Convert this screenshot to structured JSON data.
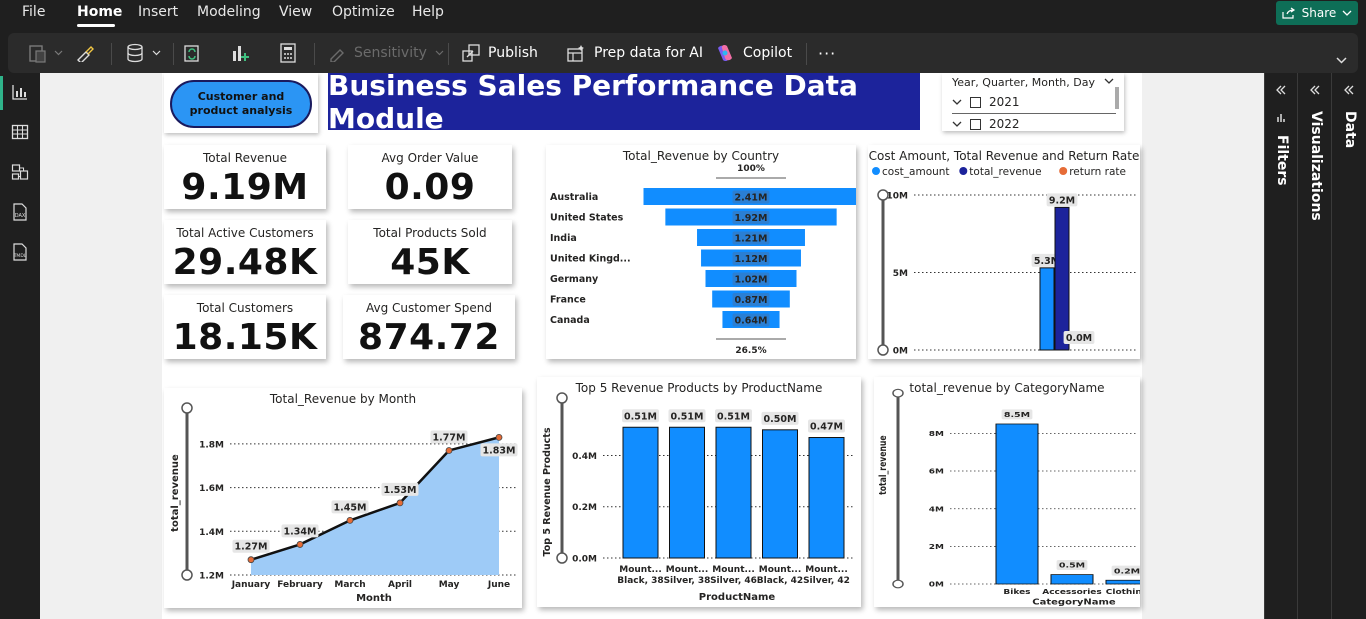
{
  "menubar": {
    "items": [
      "File",
      "Home",
      "Insert",
      "Modeling",
      "View",
      "Optimize",
      "Help"
    ],
    "share_label": "Share"
  },
  "ribbon": {
    "sensitivity_label": "Sensitivity",
    "publish_label": "Publish",
    "prep_label": "Prep data for AI",
    "copilot_label": "Copilot",
    "more_label": "···"
  },
  "panes": {
    "filters_label": "Filters",
    "visualizations_label": "Visualizations",
    "data_label": "Data"
  },
  "report": {
    "nav_button_label": "Customer and product analysis",
    "title": "Business Sales Performance Data Module",
    "slicer": {
      "header": "Year, Quarter, Month, Day",
      "items": [
        "2021",
        "2022"
      ]
    },
    "kpis": [
      {
        "label": "Total Revenue",
        "value": "9.19M"
      },
      {
        "label": "Avg Order Value",
        "value": "0.09"
      },
      {
        "label": "Total Active Customers",
        "value": "29.48K"
      },
      {
        "label": "Total Products Sold",
        "value": "45K"
      },
      {
        "label": "Total Customers",
        "value": "18.15K"
      },
      {
        "label": "Avg Customer Spend",
        "value": "874.72"
      }
    ]
  },
  "colors": {
    "accent_blue": "#118dff",
    "dark_blue": "#1c239b",
    "area_fill": "#9ecbf7",
    "orange": "#e66c37",
    "share_green": "#0e6e57"
  },
  "chart_data": [
    {
      "id": "funnel",
      "type": "funnel",
      "title": "Total_Revenue by Country",
      "top_label": "100%",
      "bottom_label": "26.5%",
      "categories": [
        "Australia",
        "United States",
        "India",
        "United Kingd...",
        "Germany",
        "France",
        "Canada"
      ],
      "values": [
        2.41,
        1.92,
        1.21,
        1.12,
        1.02,
        0.87,
        0.64
      ],
      "value_labels": [
        "2.41M",
        "1.92M",
        "1.21M",
        "1.12M",
        "1.02M",
        "0.87M",
        "0.64M"
      ]
    },
    {
      "id": "cost",
      "type": "bar",
      "title": "Cost Amount, Total Revenue and Return Rate",
      "legend": [
        {
          "name": "cost_amount",
          "color": "#118dff"
        },
        {
          "name": "total_revenue",
          "color": "#1c239b"
        },
        {
          "name": "return rate",
          "color": "#e66c37"
        }
      ],
      "series": [
        {
          "name": "cost_amount",
          "values": [
            5.3
          ],
          "label": "5.3M"
        },
        {
          "name": "total_revenue",
          "values": [
            9.2
          ],
          "label": "9.2M"
        },
        {
          "name": "return rate",
          "values": [
            0
          ],
          "label": "0.0M"
        }
      ],
      "y_ticks": [
        "10M",
        "5M",
        "0M"
      ],
      "ylim": [
        0,
        10
      ]
    },
    {
      "id": "month",
      "type": "area",
      "title": "Total_Revenue by Month",
      "xlabel": "Month",
      "ylabel": "total_revenue",
      "categories": [
        "January",
        "February",
        "March",
        "April",
        "May",
        "June"
      ],
      "values": [
        1.27,
        1.34,
        1.45,
        1.53,
        1.77,
        1.83
      ],
      "value_labels": [
        "1.27M",
        "1.34M",
        "1.45M",
        "1.53M",
        "1.77M",
        "1.83M"
      ],
      "y_ticks": [
        "1.8M",
        "1.6M",
        "1.4M",
        "1.2M"
      ],
      "ylim": [
        1.2,
        1.85
      ]
    },
    {
      "id": "products",
      "type": "bar",
      "title": "Top 5 Revenue Products by ProductName",
      "xlabel": "ProductName",
      "ylabel": "Top 5 Revenue Products",
      "categories": [
        [
          "Mount...",
          "Black, 38"
        ],
        [
          "Mount...",
          "Silver, 38"
        ],
        [
          "Mount...",
          "Silver, 46"
        ],
        [
          "Mount...",
          "Black, 42"
        ],
        [
          "Mount...",
          "Silver, 42"
        ]
      ],
      "values": [
        0.51,
        0.51,
        0.51,
        0.5,
        0.47
      ],
      "value_labels": [
        "0.51M",
        "0.51M",
        "0.51M",
        "0.50M",
        "0.47M"
      ],
      "y_ticks": [
        "0.4M",
        "0.2M",
        "0.0M"
      ],
      "ylim": [
        0,
        0.55
      ]
    },
    {
      "id": "category",
      "type": "bar",
      "title": "total_revenue by CategoryName",
      "xlabel": "CategoryName",
      "ylabel": "total_revenue",
      "categories": [
        "Bikes",
        "Accessories",
        "Clothing"
      ],
      "values": [
        8.5,
        0.5,
        0.2
      ],
      "value_labels": [
        "8.5M",
        "0.5M",
        "0.2M"
      ],
      "y_ticks": [
        "8M",
        "6M",
        "4M",
        "2M",
        "0M"
      ],
      "ylim": [
        0,
        9
      ]
    }
  ]
}
